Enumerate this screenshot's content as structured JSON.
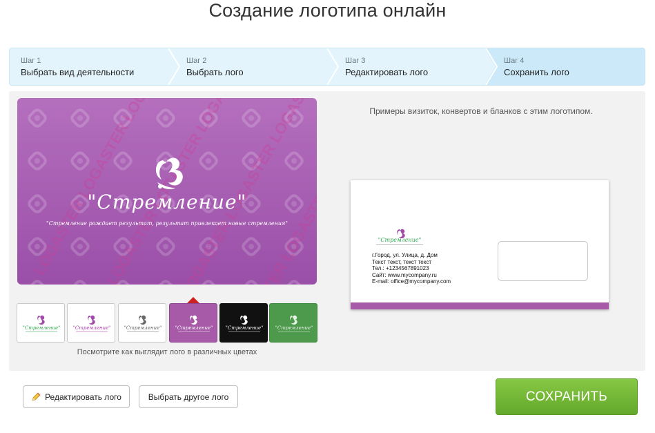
{
  "page": {
    "title": "Создание логотипа онлайн"
  },
  "steps": [
    {
      "num": "Шаг 1",
      "label": "Выбрать вид деятельности"
    },
    {
      "num": "Шаг 2",
      "label": "Выбрать лого"
    },
    {
      "num": "Шаг 3",
      "label": "Редактировать лого"
    },
    {
      "num": "Шаг 4",
      "label": "Сохранить лого",
      "active": true
    }
  ],
  "preview": {
    "logo_name": "\"Стремление\"",
    "slogan": "\"Стремление рождает результат, результат привлекает новые стремления\"",
    "watermark": "LOGASTER",
    "background": "#a85db3"
  },
  "swatches": [
    {
      "name": "white-1",
      "bg": "#ffffff",
      "text_color": "#2fa84f",
      "mark_color": "#a04aa8"
    },
    {
      "name": "white-2",
      "bg": "#ffffff",
      "text_color": "#b23bb0",
      "mark_color": "#a04aa8"
    },
    {
      "name": "white-grey",
      "bg": "#ffffff",
      "text_color": "#666666",
      "mark_color": "#666666"
    },
    {
      "name": "purple",
      "bg": "#a65aa8",
      "text_color": "#ffffff",
      "mark_color": "#ffffff",
      "selected": true
    },
    {
      "name": "black",
      "bg": "#111111",
      "text_color": "#ffffff",
      "mark_color": "#ffffff"
    },
    {
      "name": "green",
      "bg": "#4e9a4c",
      "text_color": "#e6f2e6",
      "mark_color": "#e6f2e6"
    }
  ],
  "caption": "Посмотрите как выглядит лого в различных цветах",
  "examples_text": "Примеры визиток, конвертов и бланков с этим логотипом.",
  "envelope": {
    "logo_name": "\"Стремление\"",
    "address_lines": [
      "г.Город, ул. Улица, д. Дом",
      "Текст текст, текст текст",
      "Тел.: +1234567891023",
      "Сайт: www.mycompany.ru",
      "E-mail: office@mycompany.com"
    ],
    "accent": "#a65aa8"
  },
  "buttons": {
    "edit": "Редактировать лого",
    "choose_other": "Выбрать другое лого",
    "save": "СОХРАНИТЬ"
  },
  "icons": {
    "edit": "pencil-icon"
  }
}
